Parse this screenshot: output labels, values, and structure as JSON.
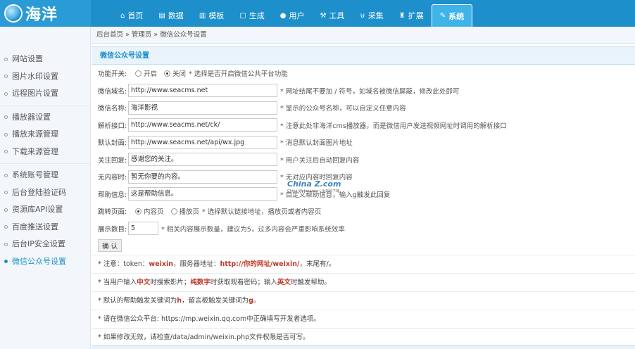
{
  "logo": {
    "text": "海洋"
  },
  "nav": [
    {
      "label": "首页",
      "icon": "home-icon",
      "glyph": "⌂"
    },
    {
      "label": "数据",
      "icon": "data-icon",
      "glyph": "▤"
    },
    {
      "label": "模板",
      "icon": "template-icon",
      "glyph": "▥"
    },
    {
      "label": "生成",
      "icon": "generate-icon",
      "glyph": "▢"
    },
    {
      "label": "用户",
      "icon": "user-icon",
      "glyph": "●"
    },
    {
      "label": "工具",
      "icon": "tool-icon",
      "glyph": "⚒"
    },
    {
      "label": "采集",
      "icon": "collect-icon",
      "glyph": "⊍"
    },
    {
      "label": "扩展",
      "icon": "extend-icon",
      "glyph": "♜"
    },
    {
      "label": "系统",
      "icon": "system-icon",
      "glyph": "✎",
      "active": true
    }
  ],
  "breadcrumb": "后台首页 » 管理员 » 微信公众号设置",
  "sidebar": {
    "group1": [
      "网站设置",
      "图片水印设置",
      "远程图片设置"
    ],
    "group2": [
      "播放器设置",
      "播放来源管理",
      "下载来源管理"
    ],
    "group3": [
      "系统账号管理",
      "后台登陆验证码",
      "资源库API设置",
      "百度推送设置",
      "后台IP安全设置",
      "微信公众号设置"
    ],
    "active": "微信公众号设置"
  },
  "form": {
    "section_title": "微信公众号设置",
    "switch": {
      "label": "功能开关:",
      "on": "开启",
      "off": "关闭",
      "selected": "off",
      "hint": "* 选择是否开启微信公共平台功能"
    },
    "domain": {
      "label": "微信域名:",
      "value": "http://www.seacms.net",
      "hint": "* 网址结尾不要加 / 符号，如域名被微信屏蔽，修改此处即可"
    },
    "name": {
      "label": "微信名称:",
      "value": "海洋影视",
      "hint": "* 显示的公众号名称，可以自定义任意内容"
    },
    "parser": {
      "label": "解析接口:",
      "value": "http://www.seacms.net/ck/",
      "hint": "* 注意此处非海洋cms播放器，而是微信用户发送视频网址时调用的解析接口"
    },
    "cover": {
      "label": "默认封面:",
      "value": "http://www.seacms.net/api/wx.jpg",
      "hint": "* 消息默认封面图片地址"
    },
    "follow": {
      "label": "关注回复:",
      "value": "感谢您的关注。",
      "hint": "* 用户关注后自动回复内容"
    },
    "nocontent": {
      "label": "无内容时:",
      "value": "暂无你要的内容。",
      "hint": "* 无对应内容时回复内容"
    },
    "help": {
      "label": "帮助信息:",
      "value": "这是帮助信息。",
      "hint": "* 自定义帮助信息，输入g触发此回复"
    },
    "jump": {
      "label": "跳转页面:",
      "opt1": "内容页",
      "opt2": "播放页",
      "selected": "opt1",
      "hint": "* 选择默认链接地址，播放页或者内容页"
    },
    "count": {
      "label": "展示数目:",
      "value": "5",
      "hint": "* 相关内容展示数量，建议为5，过多内容会严重影响系统效率"
    },
    "submit": "确 认"
  },
  "notes": {
    "n1": {
      "a": "* 注意：token：",
      "b": "weixin",
      "c": "，服务器地址：",
      "d": "http://你的网址/weixin/",
      "e": "，末尾有/。"
    },
    "n2": {
      "a": "* 当用户输入",
      "b": "中文",
      "c": "时搜索影片；",
      "d": "纯数字",
      "e": "时获取观看密码；输入",
      "f": "英文",
      "g": "时触发帮助。"
    },
    "n3": {
      "a": "* 默认的帮助触发关键词为",
      "b": "h",
      "c": "，留言板触发关键词为",
      "d": "g",
      "e": "。"
    },
    "n4": "* 请在微信公众平台: https://mp.weixin.qq.com中正确填写开发者选项。",
    "n5": "* 如果修改无效，请检查/data/admin/weixin.php文件权限是否可写。"
  },
  "watermark": {
    "main": "China Z.com",
    "sub": "China Webmaster | 为站长下载"
  }
}
